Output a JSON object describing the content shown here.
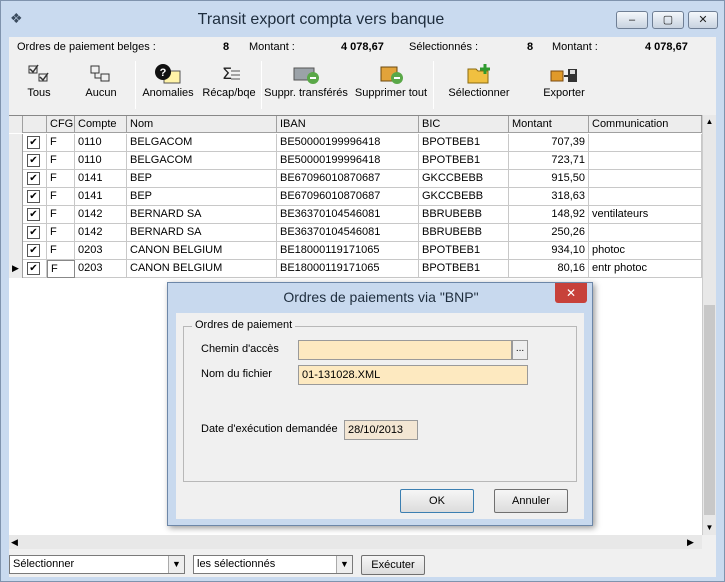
{
  "window": {
    "title": "Transit export compta vers banque",
    "min": "–",
    "max": "▢",
    "close": "✕"
  },
  "summary": {
    "ordres_label": "Ordres de paiement belges :",
    "ordres_count": "8",
    "montant_label": "Montant :",
    "montant_value": "4 078,67",
    "selected_label": "Sélectionnés :",
    "selected_count": "8",
    "selected_montant_label": "Montant :",
    "selected_montant_value": "4 078,67"
  },
  "toolbar": {
    "tous": "Tous",
    "aucun": "Aucun",
    "anomalies": "Anomalies",
    "recap": "Récap/bqe",
    "suppr_transferes": "Suppr. transférés",
    "supprimer_tout": "Supprimer tout",
    "selectionner": "Sélectionner",
    "exporter": "Exporter"
  },
  "grid": {
    "columns": [
      "CFG",
      "Compte",
      "Nom",
      "IBAN",
      "BIC",
      "Montant",
      "Communication"
    ],
    "rows": [
      {
        "checked": "✔",
        "cfg": "F",
        "compte": "0110",
        "nom": "BELGACOM",
        "iban": "BE50000199996418",
        "bic": "BPOTBEB1",
        "montant": "707,39",
        "comm": ""
      },
      {
        "checked": "✔",
        "cfg": "F",
        "compte": "0110",
        "nom": "BELGACOM",
        "iban": "BE50000199996418",
        "bic": "BPOTBEB1",
        "montant": "723,71",
        "comm": ""
      },
      {
        "checked": "✔",
        "cfg": "F",
        "compte": "0141",
        "nom": "BEP",
        "iban": "BE67096010870687",
        "bic": "GKCCBEBB",
        "montant": "915,50",
        "comm": ""
      },
      {
        "checked": "✔",
        "cfg": "F",
        "compte": "0141",
        "nom": "BEP",
        "iban": "BE67096010870687",
        "bic": "GKCCBEBB",
        "montant": "318,63",
        "comm": ""
      },
      {
        "checked": "✔",
        "cfg": "F",
        "compte": "0142",
        "nom": "BERNARD SA",
        "iban": "BE36370104546081",
        "bic": "BBRUBEBB",
        "montant": "148,92",
        "comm": "ventilateurs"
      },
      {
        "checked": "✔",
        "cfg": "F",
        "compte": "0142",
        "nom": "BERNARD SA",
        "iban": "BE36370104546081",
        "bic": "BBRUBEBB",
        "montant": "250,26",
        "comm": ""
      },
      {
        "checked": "✔",
        "cfg": "F",
        "compte": "0203",
        "nom": "CANON BELGIUM",
        "iban": "BE18000119171065",
        "bic": "BPOTBEB1",
        "montant": "934,10",
        "comm": "photoc"
      },
      {
        "checked": "✔",
        "cfg": "F",
        "compte": "0203",
        "nom": "CANON BELGIUM",
        "iban": "BE18000119171065",
        "bic": "BPOTBEB1",
        "montant": "80,16",
        "comm": "entr photoc"
      }
    ]
  },
  "bottom": {
    "select1": "Sélectionner",
    "select2": "les sélectionnés",
    "execute": "Exécuter"
  },
  "dialog": {
    "title": "Ordres de paiements via \"BNP\"",
    "close": "✕",
    "group_label": "Ordres de paiement",
    "chemin_label": "Chemin d'accès",
    "chemin_value": "",
    "browse": "...",
    "fichier_label": "Nom du fichier",
    "fichier_value": "01-131028.XML",
    "date_label": "Date d'exécution demandée",
    "date_value": "28/10/2013",
    "ok": "OK",
    "annuler": "Annuler"
  }
}
